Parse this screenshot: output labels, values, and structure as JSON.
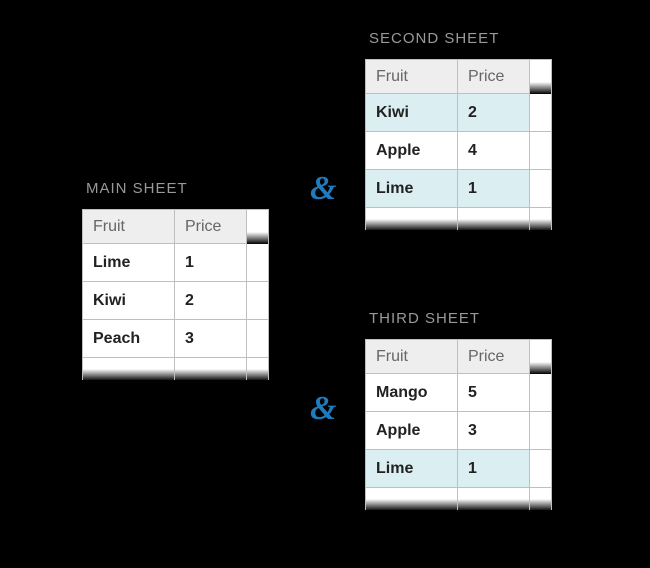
{
  "connector": "&",
  "sheets": {
    "main": {
      "title": "MAIN SHEET",
      "headers": {
        "col1": "Fruit",
        "col2": "Price"
      },
      "rows": [
        {
          "fruit": "Lime",
          "price": "1",
          "hl": false
        },
        {
          "fruit": "Kiwi",
          "price": "2",
          "hl": false
        },
        {
          "fruit": "Peach",
          "price": "3",
          "hl": false
        }
      ]
    },
    "second": {
      "title": "SECOND SHEET",
      "headers": {
        "col1": "Fruit",
        "col2": "Price"
      },
      "rows": [
        {
          "fruit": "Kiwi",
          "price": "2",
          "hl": true
        },
        {
          "fruit": "Apple",
          "price": "4",
          "hl": false
        },
        {
          "fruit": "Lime",
          "price": "1",
          "hl": true
        }
      ]
    },
    "third": {
      "title": "THIRD SHEET",
      "headers": {
        "col1": "Fruit",
        "col2": "Price"
      },
      "rows": [
        {
          "fruit": "Mango",
          "price": "5",
          "hl": false
        },
        {
          "fruit": "Apple",
          "price": "3",
          "hl": false
        },
        {
          "fruit": "Lime",
          "price": "1",
          "hl": true
        }
      ]
    }
  }
}
